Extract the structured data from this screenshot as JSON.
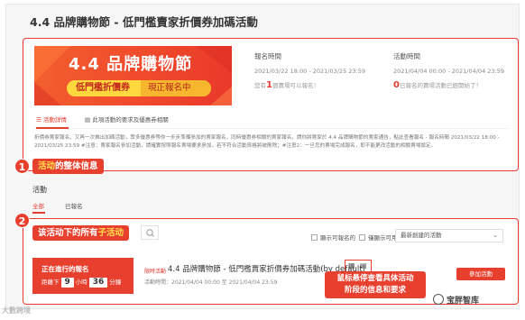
{
  "page": {
    "title": "4.4 品牌購物節 - 低門檻賣家折價券加碼活動"
  },
  "banner": {
    "title": "4.4 品牌購物節",
    "pill_main": "低門檻折價券",
    "pill_sub": "現正報名中"
  },
  "signup": {
    "label": "報名時間",
    "range": "2021/03/22 18:00 - 2021/03/25 23:59",
    "count_prefix": "您有",
    "count": "1",
    "count_suffix": "個賣場可以報名！"
  },
  "event": {
    "label": "活動時間",
    "range": "2021/04/04 00:00 - 2021/04/04 23:59",
    "count": "0",
    "count_suffix": "已報名的賣場活動已經開始了！"
  },
  "info_tabs": [
    {
      "label": "活動詳情",
      "active": true
    },
    {
      "label": "此項活動的要求及優惠券相關",
      "active": false
    }
  ],
  "description": "折價券賣家報名，又再一次推出加碼活動，眾多優惠券等你一步步準備參加的賣家報名，同時優惠券相關的賣家報名，請你將賣家於 4.4 品牌購物節的賣家通告，點此查看報名 - 報名時間 2021/03/22 18:00 - 2021/03/25 23:59 #注意：賣家報名參加活動，請確實按照報名賣場要求參加，若不符合活動資格將被刪除；#注意2：一旦您的賣場完成報名，即不能更改活動的相關賣場設定。",
  "annotation1": {
    "number": "1",
    "highlight": "活动",
    "text": "的整体信息"
  },
  "activities": {
    "title": "活動",
    "tabs": [
      {
        "label": "全部",
        "active": true
      },
      {
        "label": "已報名",
        "active": false
      }
    ]
  },
  "annotation2": {
    "number": "2",
    "text": "该活动下的所有",
    "highlight": "子活动"
  },
  "filters": {
    "check1": "顯示可報名的",
    "check2": "僅顯示可用的",
    "sort_value": "最新創建的活動"
  },
  "countdown": {
    "title": "正在進行的報名",
    "prefix": "距離下",
    "hours": "9",
    "hours_unit": "小時",
    "minutes": "36",
    "minutes_unit": "分鐘"
  },
  "sub_item": {
    "tag": "限時活動",
    "name": "4.4 品牌購物節 - 低門檻賣家折價券加碼活動(by default)",
    "time_label": "活動時間：",
    "time_range": "2021/04/04 00:00 至 2021/04/04 23:59",
    "join_label": "參加活動"
  },
  "tooltip": {
    "line1": "鼠标悬停查看具体活动",
    "line2": "阶段的信息和要求"
  },
  "watermark_left": "大數跨境",
  "watermark_right": "宝胖智库"
}
